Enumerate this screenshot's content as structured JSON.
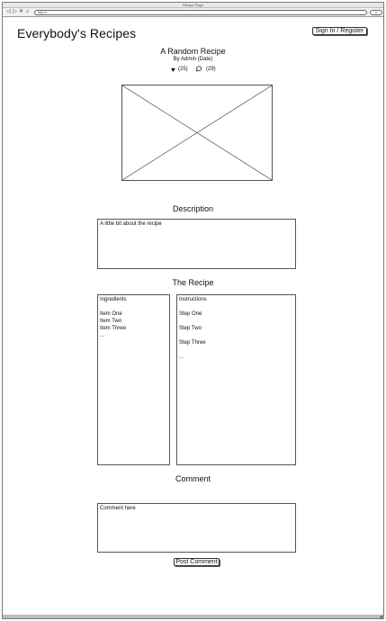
{
  "browser": {
    "title": "Recipe Page",
    "url": "http://",
    "search_label": "⌕"
  },
  "header": {
    "site_title": "Everybody's Recipes",
    "sign_in_label": "Sign In / Register"
  },
  "recipe": {
    "title": "A Random Recipe",
    "byline": "By Admin (Date)",
    "likes": "(25)",
    "comments": "(29)"
  },
  "description": {
    "heading": "Description",
    "text": "A little bit about the recipe"
  },
  "the_recipe": {
    "heading": "The Recipe",
    "ingredients": "Ingredients\n\nItem One\nItem Two\nItem Three\n...",
    "instructions": "Instructions\n\nStep One\n\nStep Two\n\nStep Three\n\n..."
  },
  "comment": {
    "heading": "Comment",
    "placeholder": "Comment here",
    "post_label": "Post Comment"
  },
  "icons": {
    "heart": "heart-icon",
    "comment": "comment-icon",
    "image": "image-placeholder-icon"
  }
}
